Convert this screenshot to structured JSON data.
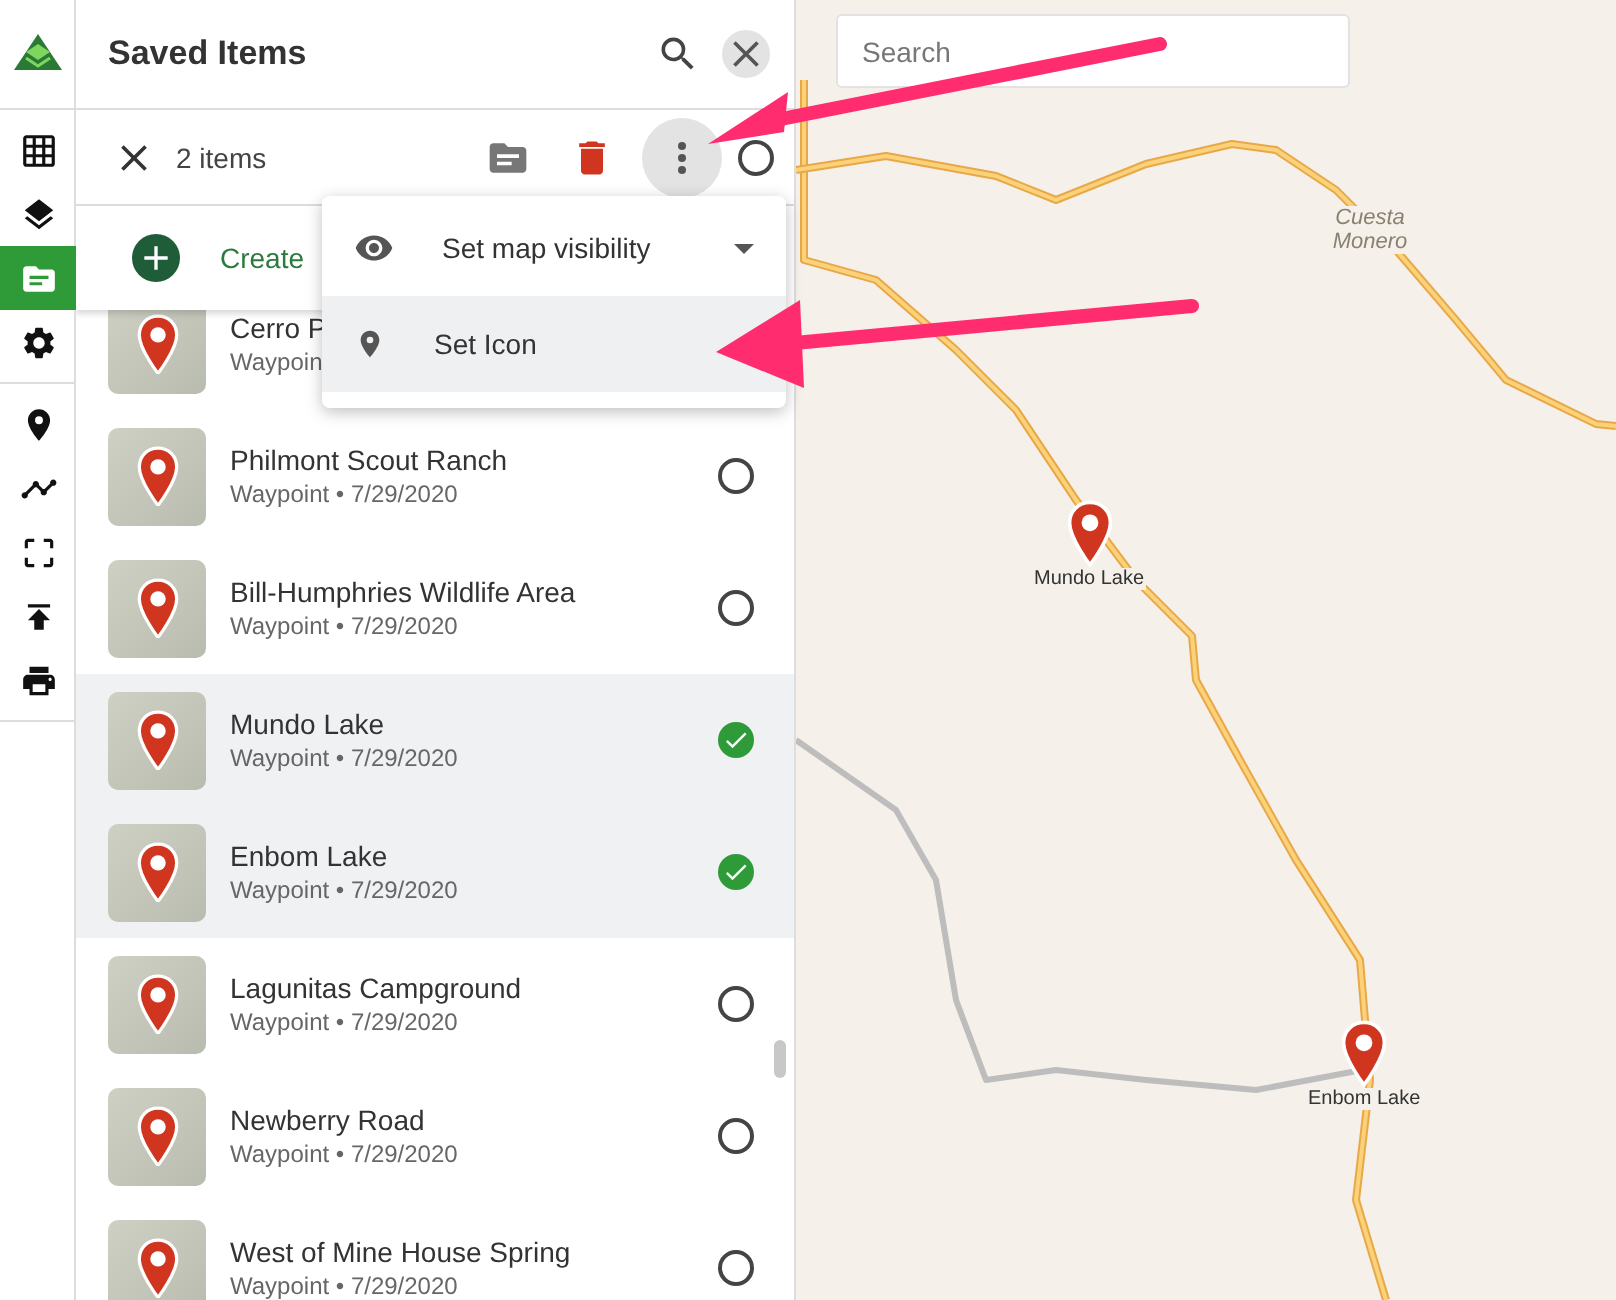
{
  "rail": {
    "items": [
      {
        "selected": false
      },
      {
        "selected": false
      },
      {
        "selected": true
      },
      {
        "selected": false
      }
    ],
    "tools": [
      {
        "selected": false
      },
      {
        "selected": false
      },
      {
        "selected": false
      },
      {
        "selected": false
      },
      {
        "selected": false
      }
    ]
  },
  "panel": {
    "title": "Saved Items",
    "selection_count": "2 items",
    "create_label": "Create",
    "select_all": {
      "checked": false
    },
    "items": [
      {
        "name": "Cerro P",
        "meta": "Waypoin",
        "selected": false
      },
      {
        "name": "Philmont Scout Ranch",
        "meta": "Waypoint • 7/29/2020",
        "selected": false
      },
      {
        "name": "Bill-Humphries Wildlife Area",
        "meta": "Waypoint • 7/29/2020",
        "selected": false
      },
      {
        "name": "Mundo Lake",
        "meta": "Waypoint • 7/29/2020",
        "selected": true
      },
      {
        "name": "Enbom Lake",
        "meta": "Waypoint • 7/29/2020",
        "selected": true
      },
      {
        "name": "Lagunitas Campground",
        "meta": "Waypoint • 7/29/2020",
        "selected": false
      },
      {
        "name": "Newberry Road",
        "meta": "Waypoint • 7/29/2020",
        "selected": false
      },
      {
        "name": "West of Mine House Spring",
        "meta": "Waypoint • 7/29/2020",
        "selected": false
      }
    ]
  },
  "menu": {
    "items": [
      {
        "kind": "dropdown",
        "label": "Set map visibility",
        "highlighted": false
      },
      {
        "kind": "action",
        "label": "Set Icon",
        "highlighted": true
      }
    ]
  },
  "map": {
    "search": {
      "placeholder": "Search"
    },
    "place_labels": [
      "Cuesta Monero"
    ],
    "markers": [
      {
        "label": "Mundo Lake"
      },
      {
        "label": "Enbom Lake"
      }
    ]
  }
}
